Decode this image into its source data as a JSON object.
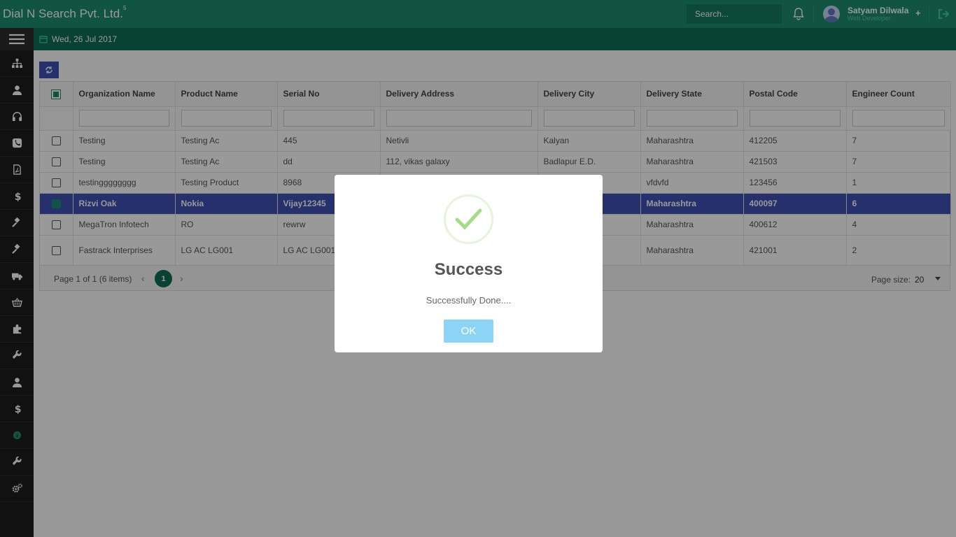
{
  "header": {
    "brand": "Dial N Search Pvt. Ltd.",
    "brand_sup": "5",
    "search_placeholder": "Search...",
    "user_name": "Satyam Dilwala",
    "user_role": "Web Developer",
    "plus": "+"
  },
  "subbar": {
    "date": "Wed, 26 Jul 2017"
  },
  "sidebar": {
    "icons": [
      "sitemap-icon",
      "user-icon",
      "headphones-icon",
      "phone-icon",
      "pdf-file-icon",
      "dollar-icon",
      "gavel-icon",
      "gavel-icon",
      "truck-icon",
      "basket-icon",
      "puzzle-icon",
      "wrench-icon",
      "user-icon",
      "dollar-icon",
      "info-icon",
      "wrench-icon",
      "cogs-icon"
    ]
  },
  "grid": {
    "columns": [
      "Organization Name",
      "Product Name",
      "Serial No",
      "Delivery Address",
      "Delivery City",
      "Delivery State",
      "Postal Code",
      "Engineer Count"
    ],
    "rows": [
      [
        "Testing",
        "Testing Ac",
        "445",
        "Netivli",
        "Kalyan",
        "Maharashtra",
        "412205",
        "7"
      ],
      [
        "Testing",
        "Testing Ac",
        "dd",
        "112, vikas galaxy",
        "Badlapur E.D.",
        "Maharashtra",
        "421503",
        "7"
      ],
      [
        "testingggggggg",
        "Testing Product",
        "8968",
        "",
        "",
        "vfdvfd",
        "123456",
        "1"
      ],
      [
        "Rizvi Oak",
        "Nokia",
        "Vijay12345",
        "",
        "",
        "Maharashtra",
        "400097",
        "6"
      ],
      [
        "MegaTron Infotech",
        "RO",
        "rewrw",
        "",
        "",
        "Maharashtra",
        "400612",
        "4"
      ],
      [
        "Fastrack Interprises",
        "LG AC LG001",
        "LG AC LG001-2",
        "",
        "",
        "Maharashtra",
        "421001",
        "2"
      ]
    ],
    "selected_row": 3
  },
  "pager": {
    "info": "Page 1 of 1 (6 items)",
    "prev": "‹",
    "current": "1",
    "next": "›",
    "size_label": "Page size:",
    "size": "20"
  },
  "modal": {
    "title": "Success",
    "text": "Successfully Done....",
    "ok": "OK"
  },
  "colors": {
    "topbar": "#1d8c6f",
    "subbar": "#0e6f55",
    "selected": "#3f51b5",
    "ok_button": "#8cd4f5"
  }
}
